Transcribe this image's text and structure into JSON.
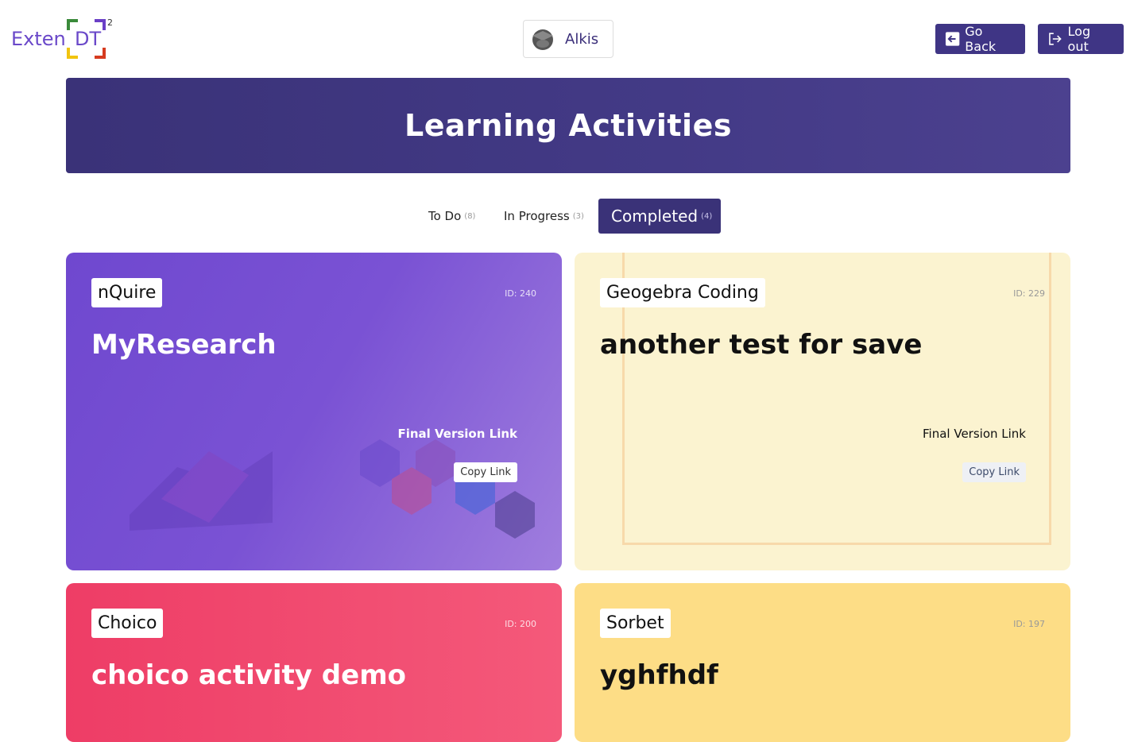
{
  "header": {
    "logo_text": "Exten",
    "logo_dt": "DT",
    "logo_sup": "2",
    "user_name": "Alkis",
    "go_back_label": "Go Back",
    "log_out_label": "Log out"
  },
  "banner": {
    "title": "Learning Activities"
  },
  "tabs": [
    {
      "label": "To Do",
      "count": "(8)"
    },
    {
      "label": "In Progress",
      "count": "(3)"
    },
    {
      "label": "Completed",
      "count": "(4)",
      "active": true
    }
  ],
  "cards": [
    {
      "tool": "nQuire",
      "id": "ID: 240",
      "title": "MyResearch",
      "final_link_label": "Final Version Link",
      "copy_label": "Copy Link",
      "color": "#7a52d4"
    },
    {
      "tool": "Geogebra Coding",
      "id": "ID: 229",
      "title": "another test for save",
      "final_link_label": "Final Version Link",
      "copy_label": "Copy Link",
      "color": "#fbf3d0"
    },
    {
      "tool": "Choico",
      "id": "ID: 200",
      "title": "choico activity demo",
      "color": "#ee3d66"
    },
    {
      "tool": "Sorbet",
      "id": "ID: 197",
      "title": "yghfhdf",
      "color": "#fddd86"
    }
  ],
  "colors": {
    "primary": "#3f3585",
    "banner": "#433a86"
  }
}
